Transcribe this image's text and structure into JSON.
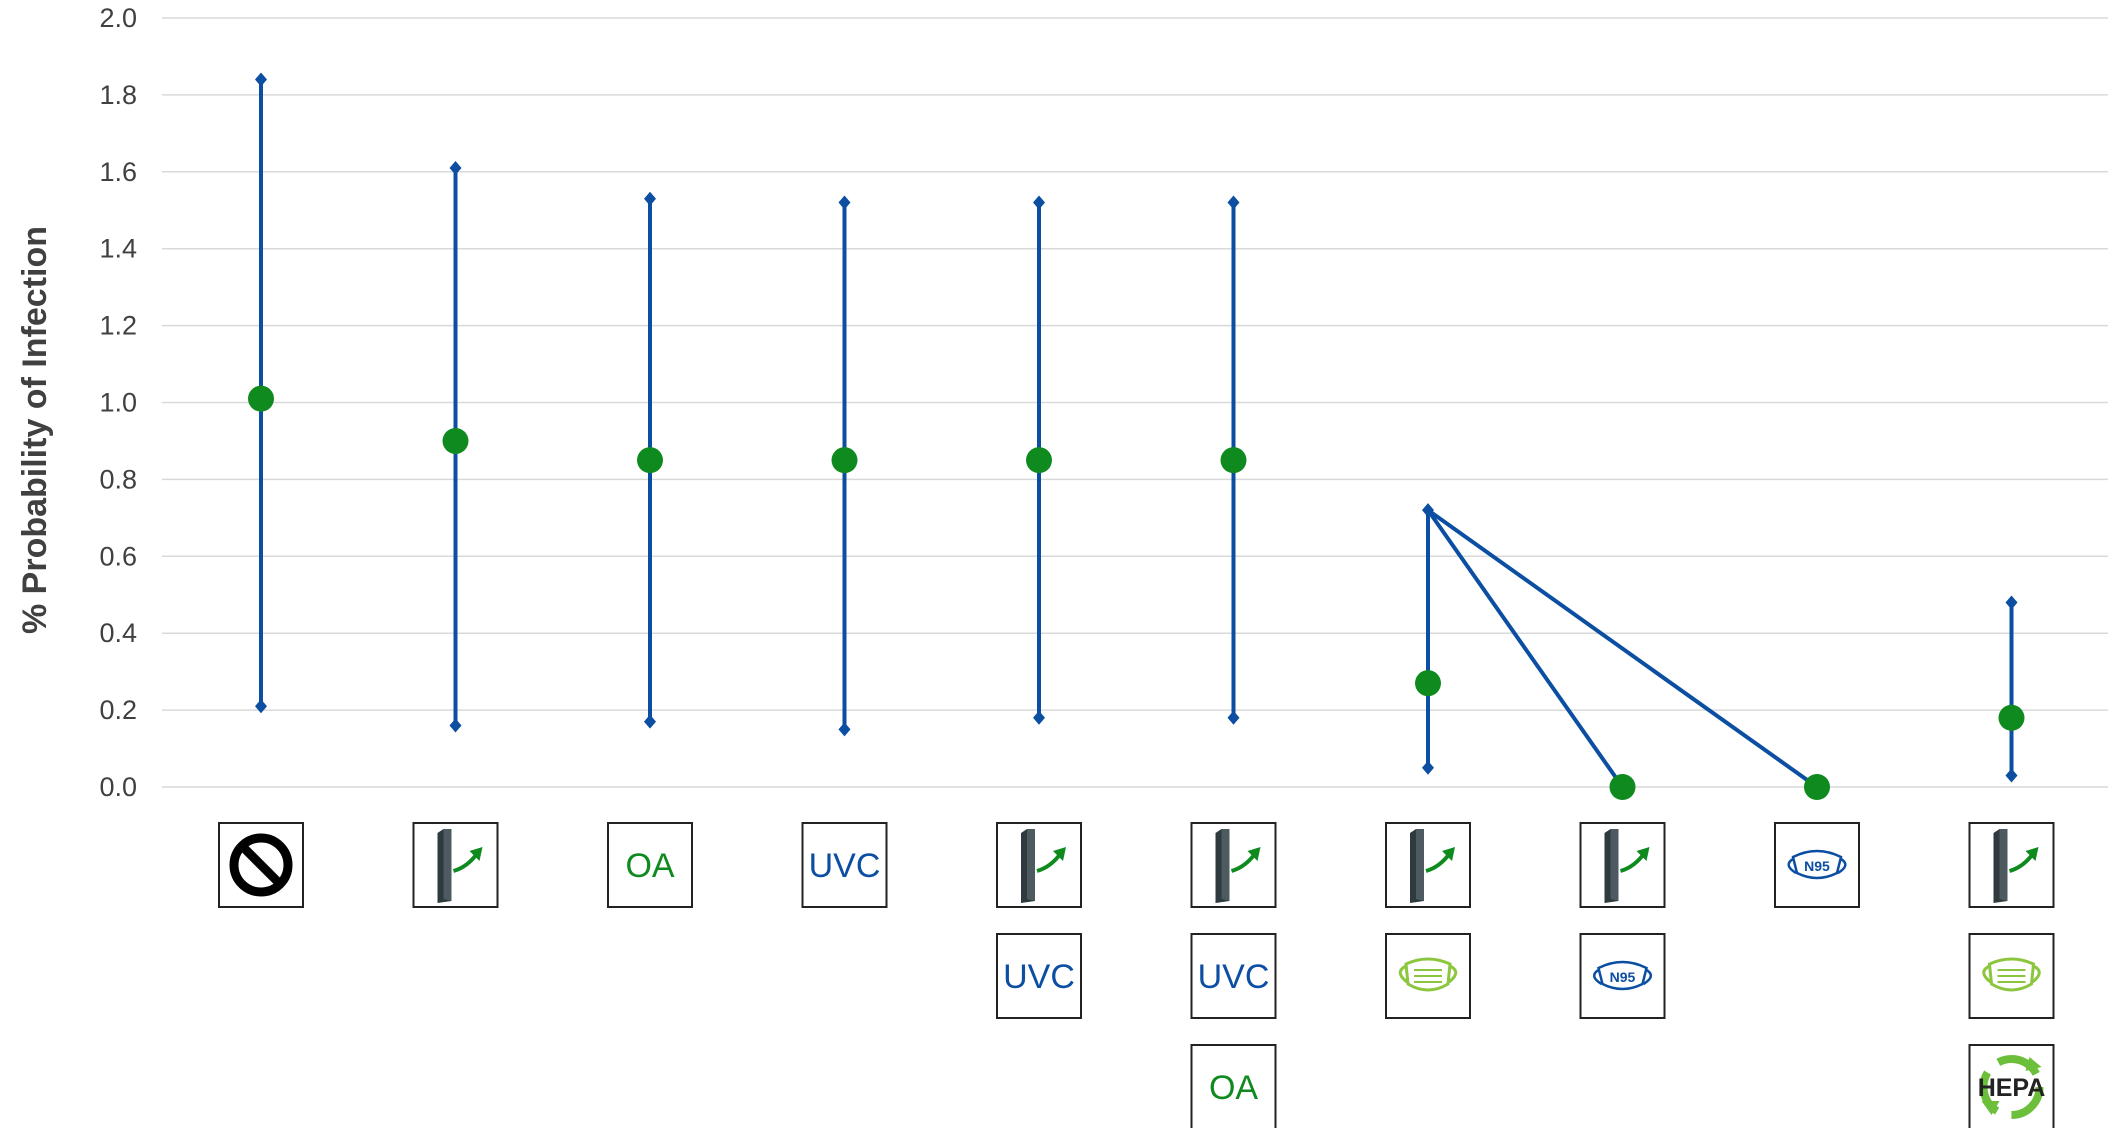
{
  "chart_data": {
    "type": "scatter",
    "ylabel": "% Probability of Infection",
    "xlabel": "",
    "ylim": [
      0,
      2.0
    ],
    "yticks": [
      "0.0",
      "0.2",
      "0.4",
      "0.6",
      "0.8",
      "1.0",
      "1.2",
      "1.4",
      "1.6",
      "1.8",
      "2.0"
    ],
    "grid": true,
    "categories": [
      {
        "icons": [
          "no-intervention"
        ]
      },
      {
        "icons": [
          "filter"
        ]
      },
      {
        "icons": [
          "outdoor-air"
        ]
      },
      {
        "icons": [
          "uvc"
        ]
      },
      {
        "icons": [
          "filter",
          "uvc"
        ]
      },
      {
        "icons": [
          "filter",
          "uvc",
          "outdoor-air"
        ]
      },
      {
        "icons": [
          "filter",
          "cloth-mask"
        ]
      },
      {
        "icons": [
          "filter",
          "n95-mask"
        ]
      },
      {
        "icons": [
          "n95-mask"
        ]
      },
      {
        "icons": [
          "filter",
          "cloth-mask",
          "hepa"
        ]
      }
    ],
    "series": [
      {
        "values": [
          1.01,
          0.9,
          0.85,
          0.85,
          0.85,
          0.85,
          0.27,
          0.0,
          0.0,
          0.18
        ],
        "lower": [
          0.21,
          0.16,
          0.17,
          0.15,
          0.18,
          0.18,
          0.05,
          null,
          null,
          0.03
        ],
        "upper": [
          1.84,
          1.61,
          1.53,
          1.52,
          1.52,
          1.52,
          0.72,
          null,
          null,
          0.48
        ]
      }
    ],
    "connectors": [
      {
        "from_category": 6,
        "to_category": 7
      },
      {
        "from_category": 6,
        "to_category": 8
      }
    ]
  },
  "labels": {
    "outdoor_air": "OA",
    "uvc": "UVC",
    "n95": "N95",
    "hepa": "HEPA"
  },
  "colors": {
    "errorbar": "#0b4ea2",
    "point": "#0f8a1f",
    "grid": "#d9d9d9",
    "axis_text": "#404040",
    "oa_text": "#0f8a1f",
    "uvc_text": "#0b4ea2",
    "mask_green": "#8cc63f",
    "n95_blue": "#0b4ea2",
    "filter_dark": "#2f3a3f",
    "hepa_green": "#6cbf3a"
  }
}
